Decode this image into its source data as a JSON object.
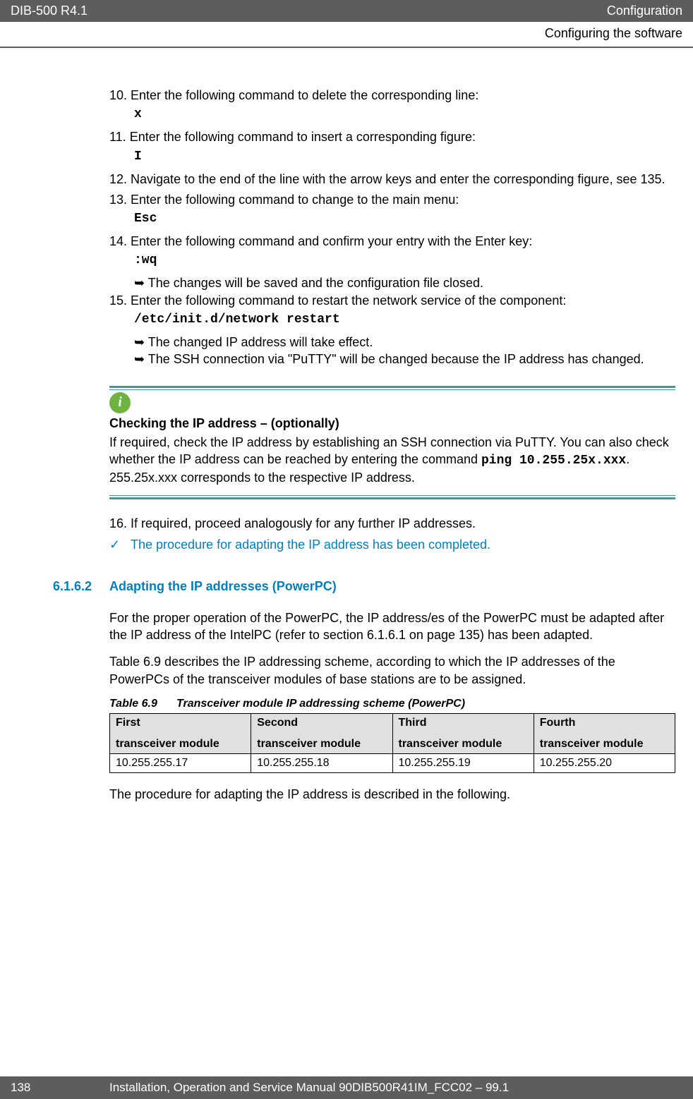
{
  "header": {
    "left": "DIB-500 R4.1",
    "right": "Configuration"
  },
  "subheader": "Configuring the software",
  "steps": {
    "s10": "Enter the following command to delete the corresponding line:",
    "code10": "x",
    "s11": "Enter the following command to insert a corresponding figure:",
    "code11": "I",
    "s12": "Navigate to the end of the line with the arrow keys and enter the corresponding figure, see 135.",
    "s13": "Enter the following command to change to the main menu:",
    "code13": "Esc",
    "s14": "Enter the following command and confirm your entry with the Enter key:",
    "code14": ":wq",
    "s14b": "➥ The changes will be saved and the configuration file closed.",
    "s15": "Enter the following command to restart the network service of the component:",
    "code15": "/etc/init.d/network restart",
    "s15b1": "➥ The changed IP address will take effect.",
    "s15b2": "➥ The SSH connection via \"PuTTY\" will be changed because the IP address has changed."
  },
  "info": {
    "title": "Checking the IP address – (optionally)",
    "body_pre": "If required, check the IP address by establishing an SSH connection via PuTTY. You can also check whether the IP address can be reached by entering the command ",
    "code": "ping 10.255.25x.xxx",
    "body_post": ". 255.25x.xxx corresponds to the respective IP address."
  },
  "s16": "If required, proceed analogously for any further IP addresses.",
  "check": "The procedure for adapting the IP address has been completed.",
  "section": {
    "num": "6.1.6.2",
    "title": "Adapting the IP addresses (PowerPC)"
  },
  "para1": "For the proper operation of the PowerPC, the IP address/es of the PowerPC must be adapted after the IP address of the IntelPC (refer to section 6.1.6.1 on page 135) has been adapted.",
  "para2": "Table 6.9 describes the IP addressing scheme, according to which the IP addresses of the PowerPCs of the transceiver modules of base stations are to be assigned.",
  "table": {
    "caption_num": "Table 6.9",
    "caption_text": "Transceiver module IP addressing scheme (PowerPC)",
    "headers": {
      "h1a": "First",
      "h1b": "transceiver module",
      "h2a": "Second",
      "h2b": "transceiver module",
      "h3a": "Third",
      "h3b": "transceiver module",
      "h4a": "Fourth",
      "h4b": "transceiver module"
    },
    "row": {
      "c1": "10.255.255.17",
      "c2": "10.255.255.18",
      "c3": "10.255.255.19",
      "c4": "10.255.255.20"
    }
  },
  "para3": "The procedure for adapting the IP address is described in the following.",
  "footer": {
    "page": "138",
    "text": "Installation, Operation and Service Manual 90DIB500R41IM_FCC02 – 99.1"
  }
}
